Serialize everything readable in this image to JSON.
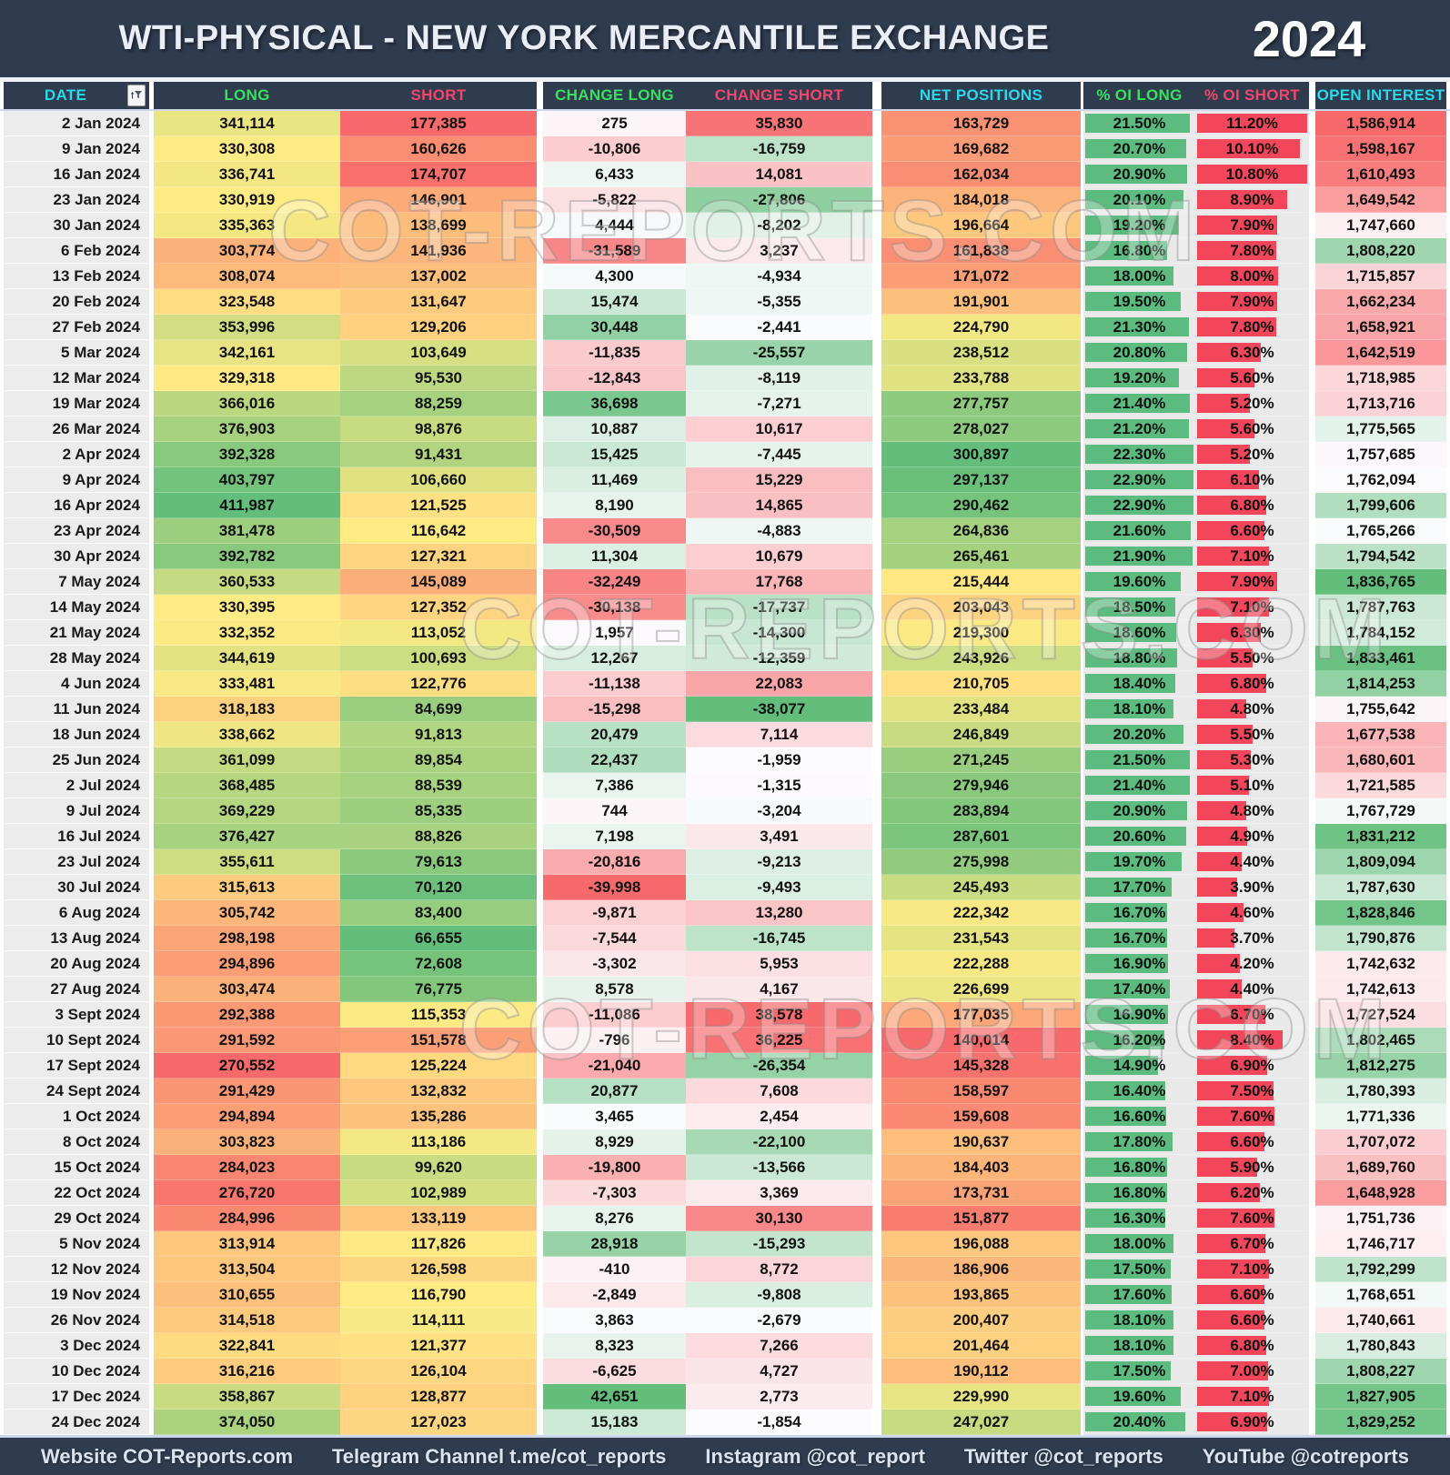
{
  "header": {
    "title": "WTI-PHYSICAL - NEW YORK MERCANTILE EXCHANGE",
    "year": "2024"
  },
  "watermark": "COT-REPORTS.COM",
  "columns": {
    "date": "DATE",
    "long": "LONG",
    "short": "SHORT",
    "change_long": "CHANGE LONG",
    "change_short": "CHANGE SHORT",
    "net_positions": "NET POSITIONS",
    "oi_long": "% OI LONG",
    "oi_short": "% OI SHORT",
    "open_interest": "OPEN INTEREST"
  },
  "colors": {
    "header_bg": "#2f3b4e",
    "accent_cyan": "#2bd9ea",
    "accent_green": "#39e25d",
    "accent_pink": "#f4456b",
    "scale_red": "#F8696B",
    "scale_yellow": "#FFEB84",
    "scale_green": "#63BE7B",
    "scale_white": "#FCFCFF",
    "bar_green": "#5cbc80",
    "bar_red": "#f4465a",
    "bar_track": "#e9e9e9",
    "date_bg": "#ececec"
  },
  "footer": {
    "items": [
      "Website COT-Reports.com",
      "Telegram Channel t.me/cot_reports",
      "Instagram @cot_report",
      "Twitter @cot_reports",
      "YouTube @cotreports"
    ]
  },
  "rows": [
    {
      "date": "2 Jan 2024",
      "long": 341114,
      "short": 177385,
      "change_long": 275,
      "change_short": 35830,
      "net_positions": 163729,
      "oi_long": 21.5,
      "oi_short": 11.2,
      "open_interest": 1586914
    },
    {
      "date": "9 Jan 2024",
      "long": 330308,
      "short": 160626,
      "change_long": -10806,
      "change_short": -16759,
      "net_positions": 169682,
      "oi_long": 20.7,
      "oi_short": 10.1,
      "open_interest": 1598167
    },
    {
      "date": "16 Jan 2024",
      "long": 336741,
      "short": 174707,
      "change_long": 6433,
      "change_short": 14081,
      "net_positions": 162034,
      "oi_long": 20.9,
      "oi_short": 10.8,
      "open_interest": 1610493
    },
    {
      "date": "23 Jan 2024",
      "long": 330919,
      "short": 146901,
      "change_long": -5822,
      "change_short": -27806,
      "net_positions": 184018,
      "oi_long": 20.1,
      "oi_short": 8.9,
      "open_interest": 1649542
    },
    {
      "date": "30 Jan 2024",
      "long": 335363,
      "short": 138699,
      "change_long": 4444,
      "change_short": -8202,
      "net_positions": 196664,
      "oi_long": 19.2,
      "oi_short": 7.9,
      "open_interest": 1747660
    },
    {
      "date": "6 Feb 2024",
      "long": 303774,
      "short": 141936,
      "change_long": -31589,
      "change_short": 3237,
      "net_positions": 161838,
      "oi_long": 16.8,
      "oi_short": 7.8,
      "open_interest": 1808220
    },
    {
      "date": "13 Feb 2024",
      "long": 308074,
      "short": 137002,
      "change_long": 4300,
      "change_short": -4934,
      "net_positions": 171072,
      "oi_long": 18.0,
      "oi_short": 8.0,
      "open_interest": 1715857
    },
    {
      "date": "20 Feb 2024",
      "long": 323548,
      "short": 131647,
      "change_long": 15474,
      "change_short": -5355,
      "net_positions": 191901,
      "oi_long": 19.5,
      "oi_short": 7.9,
      "open_interest": 1662234
    },
    {
      "date": "27 Feb 2024",
      "long": 353996,
      "short": 129206,
      "change_long": 30448,
      "change_short": -2441,
      "net_positions": 224790,
      "oi_long": 21.3,
      "oi_short": 7.8,
      "open_interest": 1658921
    },
    {
      "date": "5 Mar 2024",
      "long": 342161,
      "short": 103649,
      "change_long": -11835,
      "change_short": -25557,
      "net_positions": 238512,
      "oi_long": 20.8,
      "oi_short": 6.3,
      "open_interest": 1642519
    },
    {
      "date": "12 Mar 2024",
      "long": 329318,
      "short": 95530,
      "change_long": -12843,
      "change_short": -8119,
      "net_positions": 233788,
      "oi_long": 19.2,
      "oi_short": 5.6,
      "open_interest": 1718985
    },
    {
      "date": "19 Mar 2024",
      "long": 366016,
      "short": 88259,
      "change_long": 36698,
      "change_short": -7271,
      "net_positions": 277757,
      "oi_long": 21.4,
      "oi_short": 5.2,
      "open_interest": 1713716
    },
    {
      "date": "26 Mar 2024",
      "long": 376903,
      "short": 98876,
      "change_long": 10887,
      "change_short": 10617,
      "net_positions": 278027,
      "oi_long": 21.2,
      "oi_short": 5.6,
      "open_interest": 1775565
    },
    {
      "date": "2 Apr 2024",
      "long": 392328,
      "short": 91431,
      "change_long": 15425,
      "change_short": -7445,
      "net_positions": 300897,
      "oi_long": 22.3,
      "oi_short": 5.2,
      "open_interest": 1757685
    },
    {
      "date": "9 Apr 2024",
      "long": 403797,
      "short": 106660,
      "change_long": 11469,
      "change_short": 15229,
      "net_positions": 297137,
      "oi_long": 22.9,
      "oi_short": 6.1,
      "open_interest": 1762094
    },
    {
      "date": "16 Apr 2024",
      "long": 411987,
      "short": 121525,
      "change_long": 8190,
      "change_short": 14865,
      "net_positions": 290462,
      "oi_long": 22.9,
      "oi_short": 6.8,
      "open_interest": 1799606
    },
    {
      "date": "23 Apr 2024",
      "long": 381478,
      "short": 116642,
      "change_long": -30509,
      "change_short": -4883,
      "net_positions": 264836,
      "oi_long": 21.6,
      "oi_short": 6.6,
      "open_interest": 1765266
    },
    {
      "date": "30 Apr 2024",
      "long": 392782,
      "short": 127321,
      "change_long": 11304,
      "change_short": 10679,
      "net_positions": 265461,
      "oi_long": 21.9,
      "oi_short": 7.1,
      "open_interest": 1794542
    },
    {
      "date": "7 May 2024",
      "long": 360533,
      "short": 145089,
      "change_long": -32249,
      "change_short": 17768,
      "net_positions": 215444,
      "oi_long": 19.6,
      "oi_short": 7.9,
      "open_interest": 1836765
    },
    {
      "date": "14 May 2024",
      "long": 330395,
      "short": 127352,
      "change_long": -30138,
      "change_short": -17737,
      "net_positions": 203043,
      "oi_long": 18.5,
      "oi_short": 7.1,
      "open_interest": 1787763
    },
    {
      "date": "21 May 2024",
      "long": 332352,
      "short": 113052,
      "change_long": 1957,
      "change_short": -14300,
      "net_positions": 219300,
      "oi_long": 18.6,
      "oi_short": 6.3,
      "open_interest": 1784152
    },
    {
      "date": "28 May 2024",
      "long": 344619,
      "short": 100693,
      "change_long": 12267,
      "change_short": -12359,
      "net_positions": 243926,
      "oi_long": 18.8,
      "oi_short": 5.5,
      "open_interest": 1833461
    },
    {
      "date": "4 Jun 2024",
      "long": 333481,
      "short": 122776,
      "change_long": -11138,
      "change_short": 22083,
      "net_positions": 210705,
      "oi_long": 18.4,
      "oi_short": 6.8,
      "open_interest": 1814253
    },
    {
      "date": "11 Jun 2024",
      "long": 318183,
      "short": 84699,
      "change_long": -15298,
      "change_short": -38077,
      "net_positions": 233484,
      "oi_long": 18.1,
      "oi_short": 4.8,
      "open_interest": 1755642
    },
    {
      "date": "18 Jun 2024",
      "long": 338662,
      "short": 91813,
      "change_long": 20479,
      "change_short": 7114,
      "net_positions": 246849,
      "oi_long": 20.2,
      "oi_short": 5.5,
      "open_interest": 1677538
    },
    {
      "date": "25 Jun 2024",
      "long": 361099,
      "short": 89854,
      "change_long": 22437,
      "change_short": -1959,
      "net_positions": 271245,
      "oi_long": 21.5,
      "oi_short": 5.3,
      "open_interest": 1680601
    },
    {
      "date": "2 Jul 2024",
      "long": 368485,
      "short": 88539,
      "change_long": 7386,
      "change_short": -1315,
      "net_positions": 279946,
      "oi_long": 21.4,
      "oi_short": 5.1,
      "open_interest": 1721585
    },
    {
      "date": "9 Jul 2024",
      "long": 369229,
      "short": 85335,
      "change_long": 744,
      "change_short": -3204,
      "net_positions": 283894,
      "oi_long": 20.9,
      "oi_short": 4.8,
      "open_interest": 1767729
    },
    {
      "date": "16 Jul 2024",
      "long": 376427,
      "short": 88826,
      "change_long": 7198,
      "change_short": 3491,
      "net_positions": 287601,
      "oi_long": 20.6,
      "oi_short": 4.9,
      "open_interest": 1831212
    },
    {
      "date": "23 Jul 2024",
      "long": 355611,
      "short": 79613,
      "change_long": -20816,
      "change_short": -9213,
      "net_positions": 275998,
      "oi_long": 19.7,
      "oi_short": 4.4,
      "open_interest": 1809094
    },
    {
      "date": "30 Jul 2024",
      "long": 315613,
      "short": 70120,
      "change_long": -39998,
      "change_short": -9493,
      "net_positions": 245493,
      "oi_long": 17.7,
      "oi_short": 3.9,
      "open_interest": 1787630
    },
    {
      "date": "6 Aug 2024",
      "long": 305742,
      "short": 83400,
      "change_long": -9871,
      "change_short": 13280,
      "net_positions": 222342,
      "oi_long": 16.7,
      "oi_short": 4.6,
      "open_interest": 1828846
    },
    {
      "date": "13 Aug 2024",
      "long": 298198,
      "short": 66655,
      "change_long": -7544,
      "change_short": -16745,
      "net_positions": 231543,
      "oi_long": 16.7,
      "oi_short": 3.7,
      "open_interest": 1790876
    },
    {
      "date": "20 Aug 2024",
      "long": 294896,
      "short": 72608,
      "change_long": -3302,
      "change_short": 5953,
      "net_positions": 222288,
      "oi_long": 16.9,
      "oi_short": 4.2,
      "open_interest": 1742632
    },
    {
      "date": "27 Aug 2024",
      "long": 303474,
      "short": 76775,
      "change_long": 8578,
      "change_short": 4167,
      "net_positions": 226699,
      "oi_long": 17.4,
      "oi_short": 4.4,
      "open_interest": 1742613
    },
    {
      "date": "3 Sept 2024",
      "long": 292388,
      "short": 115353,
      "change_long": -11086,
      "change_short": 38578,
      "net_positions": 177035,
      "oi_long": 16.9,
      "oi_short": 6.7,
      "open_interest": 1727524
    },
    {
      "date": "10 Sept 2024",
      "long": 291592,
      "short": 151578,
      "change_long": -796,
      "change_short": 36225,
      "net_positions": 140014,
      "oi_long": 16.2,
      "oi_short": 8.4,
      "open_interest": 1802465
    },
    {
      "date": "17 Sept 2024",
      "long": 270552,
      "short": 125224,
      "change_long": -21040,
      "change_short": -26354,
      "net_positions": 145328,
      "oi_long": 14.9,
      "oi_short": 6.9,
      "open_interest": 1812275
    },
    {
      "date": "24 Sept 2024",
      "long": 291429,
      "short": 132832,
      "change_long": 20877,
      "change_short": 7608,
      "net_positions": 158597,
      "oi_long": 16.4,
      "oi_short": 7.5,
      "open_interest": 1780393
    },
    {
      "date": "1 Oct 2024",
      "long": 294894,
      "short": 135286,
      "change_long": 3465,
      "change_short": 2454,
      "net_positions": 159608,
      "oi_long": 16.6,
      "oi_short": 7.6,
      "open_interest": 1771336
    },
    {
      "date": "8 Oct 2024",
      "long": 303823,
      "short": 113186,
      "change_long": 8929,
      "change_short": -22100,
      "net_positions": 190637,
      "oi_long": 17.8,
      "oi_short": 6.6,
      "open_interest": 1707072
    },
    {
      "date": "15 Oct 2024",
      "long": 284023,
      "short": 99620,
      "change_long": -19800,
      "change_short": -13566,
      "net_positions": 184403,
      "oi_long": 16.8,
      "oi_short": 5.9,
      "open_interest": 1689760
    },
    {
      "date": "22 Oct 2024",
      "long": 276720,
      "short": 102989,
      "change_long": -7303,
      "change_short": 3369,
      "net_positions": 173731,
      "oi_long": 16.8,
      "oi_short": 6.2,
      "open_interest": 1648928
    },
    {
      "date": "29 Oct 2024",
      "long": 284996,
      "short": 133119,
      "change_long": 8276,
      "change_short": 30130,
      "net_positions": 151877,
      "oi_long": 16.3,
      "oi_short": 7.6,
      "open_interest": 1751736
    },
    {
      "date": "5 Nov 2024",
      "long": 313914,
      "short": 117826,
      "change_long": 28918,
      "change_short": -15293,
      "net_positions": 196088,
      "oi_long": 18.0,
      "oi_short": 6.7,
      "open_interest": 1746717
    },
    {
      "date": "12 Nov 2024",
      "long": 313504,
      "short": 126598,
      "change_long": -410,
      "change_short": 8772,
      "net_positions": 186906,
      "oi_long": 17.5,
      "oi_short": 7.1,
      "open_interest": 1792299
    },
    {
      "date": "19 Nov 2024",
      "long": 310655,
      "short": 116790,
      "change_long": -2849,
      "change_short": -9808,
      "net_positions": 193865,
      "oi_long": 17.6,
      "oi_short": 6.6,
      "open_interest": 1768651
    },
    {
      "date": "26 Nov 2024",
      "long": 314518,
      "short": 114111,
      "change_long": 3863,
      "change_short": -2679,
      "net_positions": 200407,
      "oi_long": 18.1,
      "oi_short": 6.6,
      "open_interest": 1740661
    },
    {
      "date": "3 Dec 2024",
      "long": 322841,
      "short": 121377,
      "change_long": 8323,
      "change_short": 7266,
      "net_positions": 201464,
      "oi_long": 18.1,
      "oi_short": 6.8,
      "open_interest": 1780843
    },
    {
      "date": "10 Dec 2024",
      "long": 316216,
      "short": 126104,
      "change_long": -6625,
      "change_short": 4727,
      "net_positions": 190112,
      "oi_long": 17.5,
      "oi_short": 7.0,
      "open_interest": 1808227
    },
    {
      "date": "17 Dec 2024",
      "long": 358867,
      "short": 128877,
      "change_long": 42651,
      "change_short": 2773,
      "net_positions": 229990,
      "oi_long": 19.6,
      "oi_short": 7.1,
      "open_interest": 1827905
    },
    {
      "date": "24 Dec 2024",
      "long": 374050,
      "short": 127023,
      "change_long": 15183,
      "change_short": -1854,
      "net_positions": 247027,
      "oi_long": 20.4,
      "oi_short": 6.9,
      "open_interest": 1829252
    }
  ]
}
